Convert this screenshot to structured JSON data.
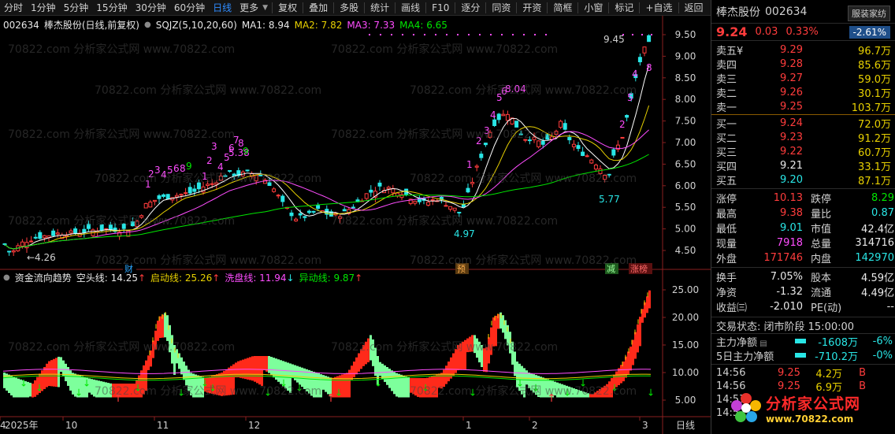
{
  "toolbar": {
    "periods": [
      "分时",
      "1分钟",
      "5分钟",
      "15分钟",
      "30分钟",
      "60分钟",
      "日线",
      "更多"
    ],
    "active_period": "日线",
    "tools": [
      "复权",
      "叠加",
      "多股",
      "统计",
      "画线",
      "F10",
      "逐分",
      "同资",
      "开资",
      "简框",
      "小窗",
      "标记",
      "+自选",
      "返回"
    ]
  },
  "chart": {
    "header": {
      "code": "002634",
      "name": "棒杰股份(日线,前复权)",
      "indicator": "SQJZ(5,10,20,60)",
      "ma1": "MA1: 8.94",
      "ma2": "MA2: 7.82",
      "ma3": "MA3: 7.33",
      "ma4": "MA4: 6.65",
      "ma_colors": [
        "#ffffff",
        "#e8d100",
        "#ff4dff",
        "#00e600"
      ]
    },
    "price_axis": [
      "9.50",
      "9.00",
      "8.50",
      "8.00",
      "7.50",
      "7.00",
      "6.50",
      "6.00",
      "5.50",
      "5.00",
      "4.50"
    ],
    "annotations": {
      "high": "9.45",
      "low": "←4.26",
      "low2": "4.97",
      "low3": "5.77",
      "peak": "8.04",
      "c1": "5.38"
    },
    "events": {
      "cai": "财",
      "yu": "预",
      "jian": "减",
      "zhangbang": "涨榜"
    },
    "seq_labels_a": [
      "1",
      "2",
      "3",
      "4",
      "5",
      "6",
      "8",
      "9"
    ],
    "seq_labels_b": [
      "1",
      "2",
      "3",
      "4",
      "5",
      "6",
      "7",
      "8",
      "9"
    ]
  },
  "indicator_panel": {
    "title": "资金流向趋势",
    "kongtou": "空头线: 14.25",
    "qidong": "启动线: 25.26",
    "xipan": "洗盘线: 11.94",
    "yidong": "异动线: 9.87",
    "axis": [
      "25.00",
      "20.00",
      "15.00",
      "10.00",
      "5.00"
    ]
  },
  "x_axis": {
    "labels": [
      "2025年",
      "10",
      "11",
      "12",
      "1",
      "2",
      "3",
      "4"
    ],
    "mode": "日线"
  },
  "watermark": "70822.com 分析家公式网 www.70822.com",
  "quote": {
    "name": "棒杰股份",
    "code": "002634",
    "badge": "服装家纺",
    "price": "9.24",
    "change": "0.03",
    "pct": "0.33%",
    "sector_pct": "-2.61%",
    "asks": [
      {
        "label": "卖五",
        "price": "9.29",
        "vol": "96.7万",
        "mark": "¥"
      },
      {
        "label": "卖四",
        "price": "9.28",
        "vol": "85.6万",
        "mark": ""
      },
      {
        "label": "卖三",
        "price": "9.27",
        "vol": "59.0万",
        "mark": ""
      },
      {
        "label": "卖二",
        "price": "9.26",
        "vol": "30.1万",
        "mark": ""
      },
      {
        "label": "卖一",
        "price": "9.25",
        "vol": "103.7万",
        "mark": ""
      }
    ],
    "bids": [
      {
        "label": "买一",
        "price": "9.24",
        "vol": "72.0万"
      },
      {
        "label": "买二",
        "price": "9.23",
        "vol": "91.2万"
      },
      {
        "label": "买三",
        "price": "9.22",
        "vol": "60.7万"
      },
      {
        "label": "买四",
        "price": "9.21",
        "vol": "33.1万"
      },
      {
        "label": "买五",
        "price": "9.20",
        "vol": "87.1万"
      }
    ],
    "stats1": [
      {
        "k": "涨停",
        "v": "10.13",
        "k2": "跌停",
        "v2": "8.29"
      },
      {
        "k": "最高",
        "v": "9.38",
        "k2": "量比",
        "v2": "0.87"
      },
      {
        "k": "最低",
        "v": "9.01",
        "k2": "市值",
        "v2": "42.4亿"
      },
      {
        "k": "现量",
        "v": "7918",
        "k2": "总量",
        "v2": "314716"
      },
      {
        "k": "外盘",
        "v": "171746",
        "k2": "内盘",
        "v2": "142970"
      }
    ],
    "stats2": [
      {
        "k": "换手",
        "v": "7.05%",
        "k2": "股本",
        "v2": "4.59亿"
      },
      {
        "k": "净资",
        "v": "-1.32",
        "k2": "流通",
        "v2": "4.49亿"
      },
      {
        "k": "收益㈢",
        "v": "-2.010",
        "k2": "PE(动)",
        "v2": "--"
      }
    ],
    "status": "交易状态: 闭市阶段 15:00:00",
    "flows": [
      {
        "k": "主力净额",
        "v": "-1608万",
        "p": "-6%"
      },
      {
        "k": "5日主力净额",
        "v": "-710.2万",
        "p": "-0%"
      }
    ],
    "ticks": [
      {
        "t": "14:56",
        "p": "9.25",
        "v": "4.2万",
        "d": "B"
      },
      {
        "t": "14:56",
        "p": "9.25",
        "v": "6.9万",
        "d": "B"
      },
      {
        "t": "14:57",
        "p": "",
        "v": "",
        "d": ""
      },
      {
        "t": "14:57",
        "p": "",
        "v": "",
        "d": ""
      }
    ]
  },
  "logo": {
    "line1": "分析家公式网",
    "line2": "www.70822.com"
  }
}
